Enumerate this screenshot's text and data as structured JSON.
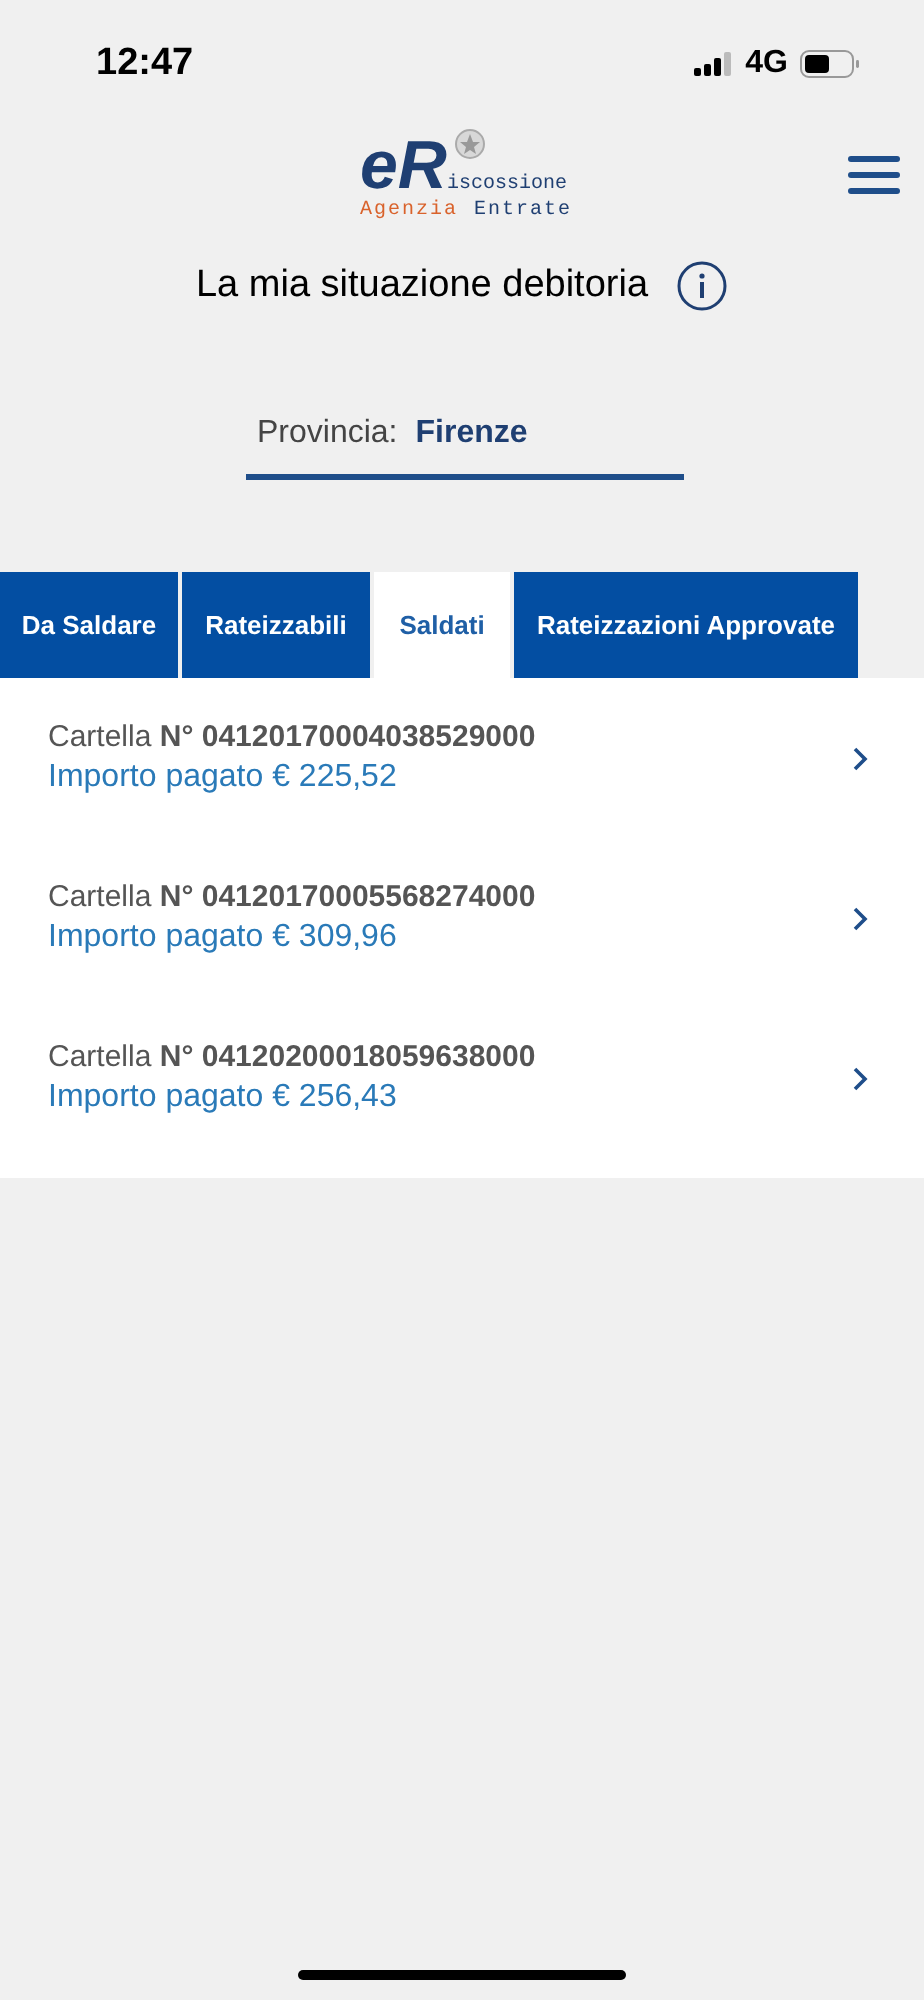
{
  "status_bar": {
    "time": "12:47",
    "network": "4G"
  },
  "logo": {
    "mark_left": "e",
    "mark_right": "R",
    "name": "iscossione",
    "line2_left": "Agenzia",
    "line2_right": "Entrate"
  },
  "title": "La mia situazione debitoria",
  "province": {
    "label": "Provincia:",
    "value": "Firenze"
  },
  "tabs": [
    {
      "label": "Da Saldare",
      "selected": false
    },
    {
      "label": "Rateizzabili",
      "selected": false
    },
    {
      "label": "Saldati",
      "selected": true
    },
    {
      "label": "Rateizzazioni Approvate",
      "selected": false
    }
  ],
  "items": [
    {
      "number": "Cartella **N° 04120170004038529000**",
      "amount": "Importo pagato € 225,52"
    },
    {
      "number": "Cartella **N° 04120170005568274000**",
      "amount": "Importo pagato € 309,96"
    },
    {
      "number": "Cartella **N° 04120200018059638000**",
      "amount": "Importo pagato € 256,43"
    }
  ]
}
